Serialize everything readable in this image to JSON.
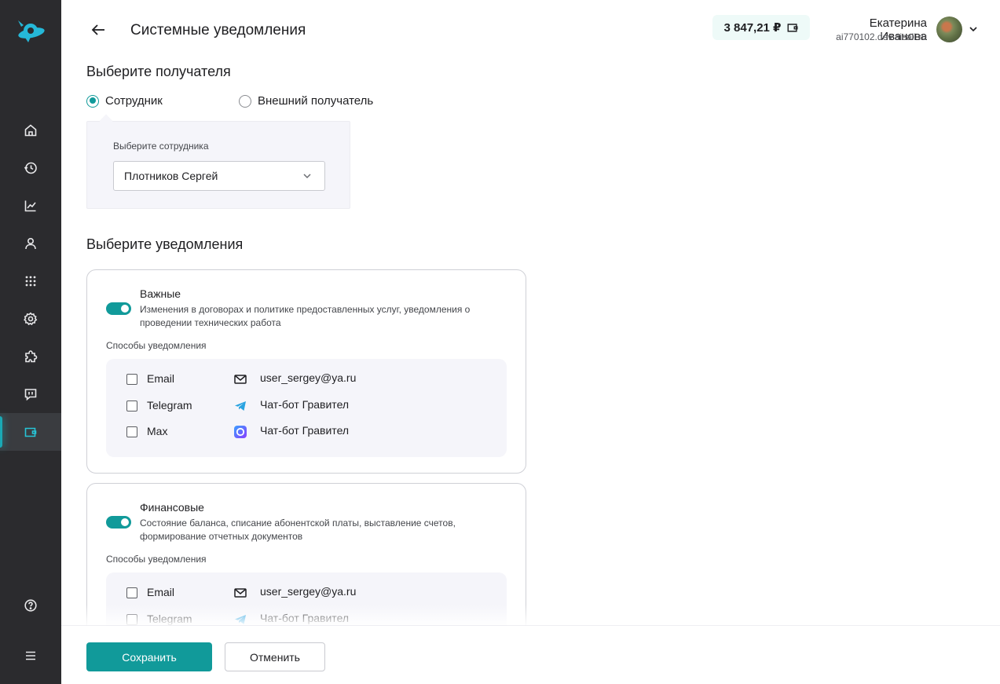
{
  "header": {
    "title": "Системные уведомления",
    "balance": "3 847,21 ₽",
    "user_name": "Екатерина Иванова",
    "user_domain": "ai770102.dev.aicall.ru"
  },
  "sidebar": {
    "items": [
      {
        "name": "home-icon"
      },
      {
        "name": "history-icon"
      },
      {
        "name": "analytics-icon"
      },
      {
        "name": "user-icon"
      },
      {
        "name": "dialpad-icon"
      },
      {
        "name": "gear-icon"
      },
      {
        "name": "puzzle-icon"
      },
      {
        "name": "chat-icon"
      },
      {
        "name": "wallet-icon",
        "active": true
      },
      {
        "name": "help-icon"
      },
      {
        "name": "menu-icon"
      }
    ]
  },
  "recipient": {
    "title": "Выберите получателя",
    "options": [
      "Сотрудник",
      "Внешний получатель"
    ],
    "selected": "Сотрудник",
    "employee_label": "Выберите сотрудника",
    "employee_value": "Плотников Сергей"
  },
  "notifications": {
    "title": "Выберите уведомления",
    "cards": [
      {
        "title": "Важные",
        "description": "Изменения в договорах и политике предоставленных услуг, уведомления о проведении технических работа",
        "enabled": true,
        "methods_label": "Способы уведомления",
        "methods": [
          {
            "name": "Email",
            "value": "user_sergey@ya.ru",
            "icon": "mail-icon",
            "checked": false
          },
          {
            "name": "Telegram",
            "value": "Чат-бот Гравител",
            "icon": "telegram-icon",
            "checked": false
          },
          {
            "name": "Max",
            "value": "Чат-бот Гравител",
            "icon": "max-icon",
            "checked": false
          }
        ]
      },
      {
        "title": "Финансовые",
        "description": "Состояние баланса, списание абонентской платы, выставление счетов, формирование отчетных документов",
        "enabled": true,
        "methods_label": "Способы уведомления",
        "methods": [
          {
            "name": "Email",
            "value": "user_sergey@ya.ru",
            "icon": "mail-icon",
            "checked": false
          },
          {
            "name": "Telegram",
            "value": "Чат-бот Гравител",
            "icon": "telegram-icon",
            "checked": false
          }
        ]
      }
    ]
  },
  "footer": {
    "save_label": "Сохранить",
    "cancel_label": "Отменить"
  },
  "colors": {
    "accent": "#119a9a",
    "sidebar_bg": "#2b2b2e",
    "panel_bg": "#f5f5fa"
  }
}
